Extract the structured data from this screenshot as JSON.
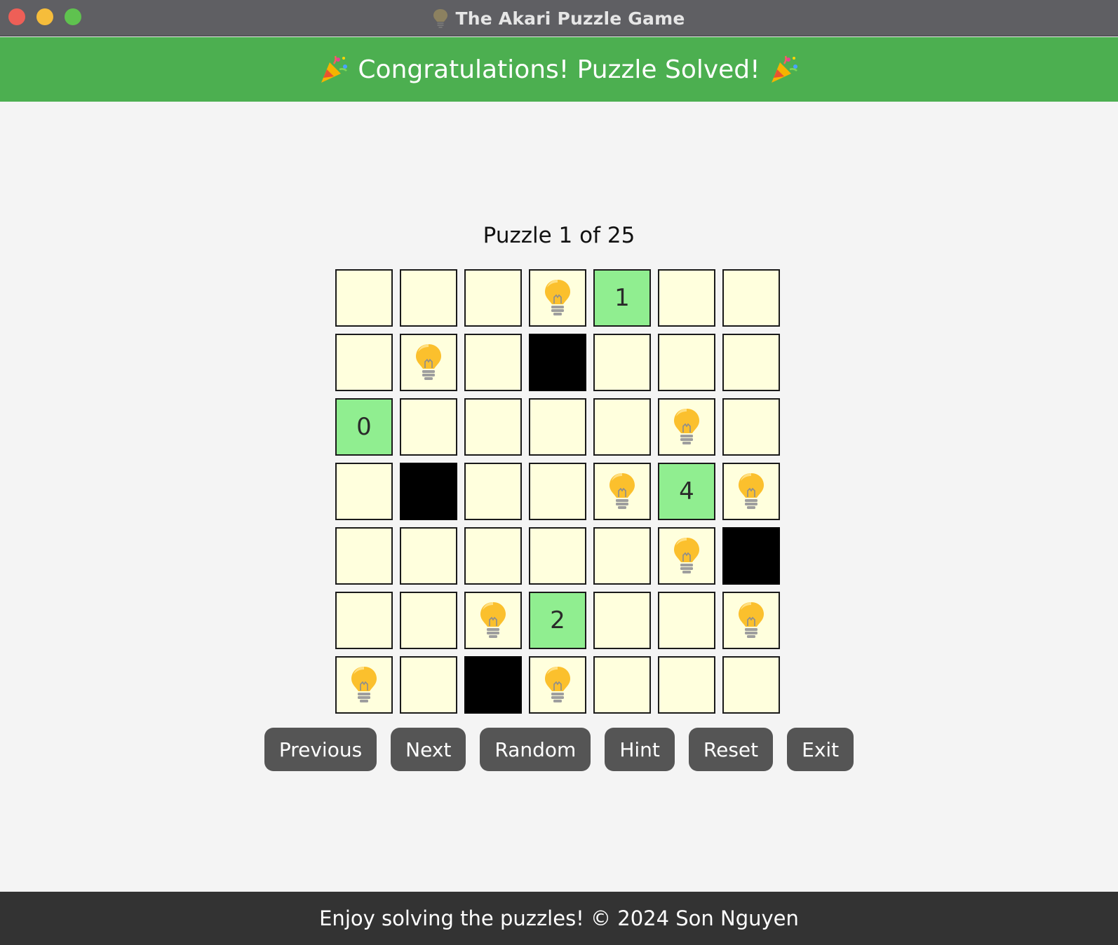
{
  "window": {
    "title": "The Akari Puzzle Game",
    "title_icon": "lightbulb-icon"
  },
  "banner": {
    "message": "Congratulations! Puzzle Solved!",
    "icon": "party-popper-icon",
    "color": "#4caf50"
  },
  "puzzle": {
    "label": "Puzzle 1 of 25",
    "rows": 7,
    "cols": 7,
    "grid": [
      [
        "",
        "",
        "",
        "L",
        "1",
        "",
        ""
      ],
      [
        "",
        "L",
        "",
        "B",
        "",
        "",
        ""
      ],
      [
        "0",
        "",
        "",
        "",
        "",
        "L",
        ""
      ],
      [
        "",
        "B",
        "",
        "",
        "L",
        "4",
        "L"
      ],
      [
        "",
        "",
        "",
        "",
        "",
        "L",
        "B"
      ],
      [
        "",
        "",
        "L",
        "2",
        "",
        "",
        "L"
      ],
      [
        "L",
        "",
        "B",
        "L",
        "",
        "",
        ""
      ]
    ],
    "legend": {
      "L": "lightbulb",
      "B": "black cell",
      "digits": "numbered black cell (satisfied)"
    },
    "colors": {
      "lit_cell": "#ffffdd",
      "numbered_cell": "#90ee90",
      "black_cell": "#000000"
    }
  },
  "buttons": [
    {
      "label": "Previous",
      "name": "previous-button"
    },
    {
      "label": "Next",
      "name": "next-button"
    },
    {
      "label": "Random",
      "name": "random-button"
    },
    {
      "label": "Hint",
      "name": "hint-button"
    },
    {
      "label": "Reset",
      "name": "reset-button"
    },
    {
      "label": "Exit",
      "name": "exit-button"
    }
  ],
  "footer": {
    "text": "Enjoy solving the puzzles! © 2024 Son Nguyen"
  }
}
